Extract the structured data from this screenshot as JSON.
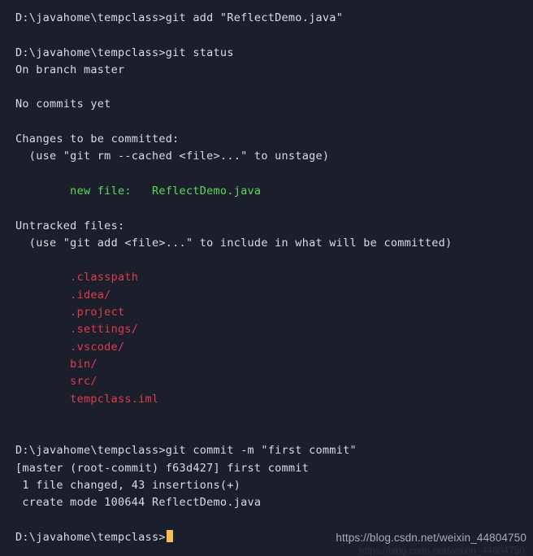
{
  "terminal": {
    "background_color": "#1b1f2b",
    "default_text_color": "#d8dce6",
    "green_color": "#5fd75f",
    "red_color": "#e03b4f",
    "cursor_color": "#f2c14e",
    "prompt": "D:\\javahome\\tempclass>",
    "lines": [
      {
        "id": "l01",
        "color": "default",
        "text": "D:\\javahome\\tempclass>git add \"ReflectDemo.java\""
      },
      {
        "id": "l02",
        "color": "default",
        "text": ""
      },
      {
        "id": "l03",
        "color": "default",
        "text": "D:\\javahome\\tempclass>git status"
      },
      {
        "id": "l04",
        "color": "default",
        "text": "On branch master"
      },
      {
        "id": "l05",
        "color": "default",
        "text": ""
      },
      {
        "id": "l06",
        "color": "default",
        "text": "No commits yet"
      },
      {
        "id": "l07",
        "color": "default",
        "text": ""
      },
      {
        "id": "l08",
        "color": "default",
        "text": "Changes to be committed:"
      },
      {
        "id": "l09",
        "color": "default",
        "text": "  (use \"git rm --cached <file>...\" to unstage)"
      },
      {
        "id": "l10",
        "color": "default",
        "text": ""
      },
      {
        "id": "l11",
        "color": "green",
        "text": "        new file:   ReflectDemo.java"
      },
      {
        "id": "l12",
        "color": "default",
        "text": ""
      },
      {
        "id": "l13",
        "color": "default",
        "text": "Untracked files:"
      },
      {
        "id": "l14",
        "color": "default",
        "text": "  (use \"git add <file>...\" to include in what will be committed)"
      },
      {
        "id": "l15",
        "color": "default",
        "text": ""
      },
      {
        "id": "l16",
        "color": "red",
        "text": "        .classpath"
      },
      {
        "id": "l17",
        "color": "red",
        "text": "        .idea/"
      },
      {
        "id": "l18",
        "color": "red",
        "text": "        .project"
      },
      {
        "id": "l19",
        "color": "red",
        "text": "        .settings/"
      },
      {
        "id": "l20",
        "color": "red",
        "text": "        .vscode/"
      },
      {
        "id": "l21",
        "color": "red",
        "text": "        bin/"
      },
      {
        "id": "l22",
        "color": "red",
        "text": "        src/"
      },
      {
        "id": "l23",
        "color": "red",
        "text": "        tempclass.iml"
      },
      {
        "id": "l24",
        "color": "default",
        "text": ""
      },
      {
        "id": "l25",
        "color": "default",
        "text": ""
      },
      {
        "id": "l26",
        "color": "default",
        "text": "D:\\javahome\\tempclass>git commit -m \"first commit\""
      },
      {
        "id": "l27",
        "color": "default",
        "text": "[master (root-commit) f63d427] first commit"
      },
      {
        "id": "l28",
        "color": "default",
        "text": " 1 file changed, 43 insertions(+)"
      },
      {
        "id": "l29",
        "color": "default",
        "text": " create mode 100644 ReflectDemo.java"
      },
      {
        "id": "l30",
        "color": "default",
        "text": ""
      }
    ],
    "current_prompt_line": "D:\\javahome\\tempclass>",
    "cursor": {
      "visible": true,
      "shape": "block"
    }
  },
  "watermark": {
    "text": "https://blog.csdn.net/weixin_44804750",
    "color": "#a9adb8"
  }
}
